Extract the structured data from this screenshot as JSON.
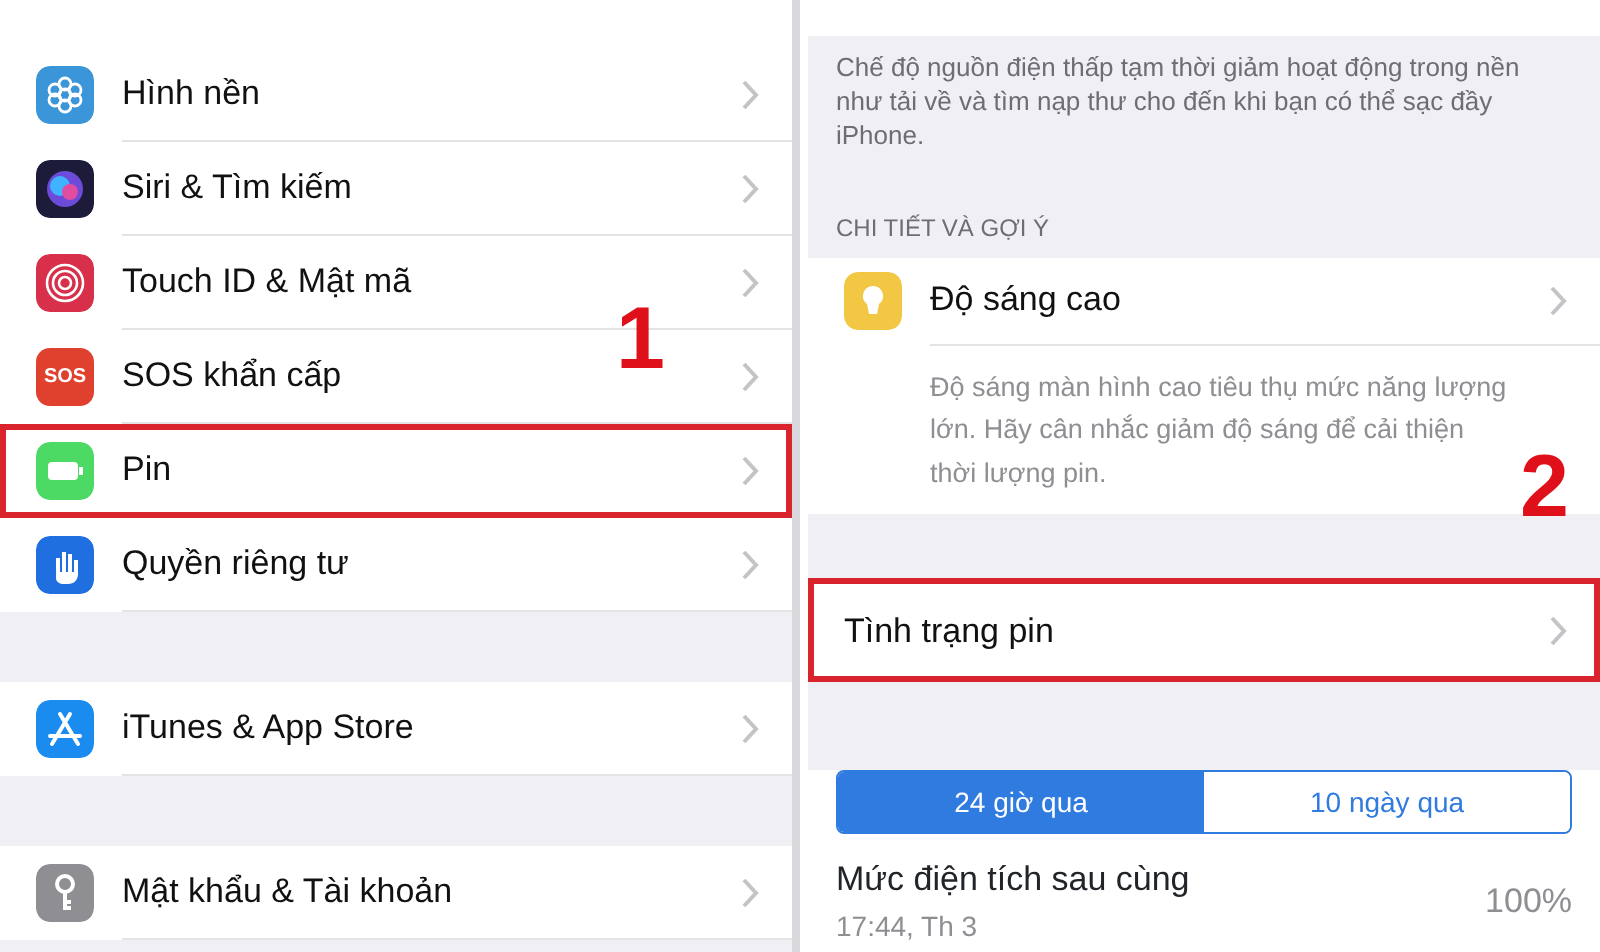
{
  "left_screen": {
    "groups": [
      {
        "items": [
          {
            "label": "Hình nền",
            "kind": "wallpaper",
            "highlighted": false
          },
          {
            "label": "Siri & Tìm kiếm",
            "kind": "siri",
            "highlighted": false
          },
          {
            "label": "Touch ID & Mật mã",
            "kind": "fingerprint",
            "highlighted": false
          },
          {
            "label": "SOS khẩn cấp",
            "kind": "sos",
            "icon_text": "SOS",
            "highlighted": false
          },
          {
            "label": "Pin",
            "kind": "battery",
            "highlighted": true
          },
          {
            "label": "Quyền riêng tư",
            "kind": "hand",
            "highlighted": false
          }
        ]
      },
      {
        "items": [
          {
            "label": "iTunes & App Store",
            "kind": "appstore",
            "highlighted": false
          }
        ]
      },
      {
        "items": [
          {
            "label": "Mật khẩu & Tài khoản",
            "kind": "key",
            "highlighted": false
          }
        ]
      }
    ],
    "step_label": "1"
  },
  "right_screen": {
    "low_power_note": "Chế độ nguồn điện thấp tạm thời giảm hoạt động trong nền như tải về và tìm nạp thư cho đến khi bạn có thể sạc đầy iPhone.",
    "section_header": "CHI TIẾT VÀ GỢI Ý",
    "suggestion": {
      "title": "Độ sáng cao",
      "description": "Độ sáng màn hình cao tiêu thụ mức năng lượng lớn. Hãy cân nhắc giảm độ sáng để cải thiện thời lượng pin."
    },
    "health_row": {
      "label": "Tình trạng pin",
      "highlighted": true
    },
    "segments": [
      {
        "label": "24 giờ qua",
        "selected": true
      },
      {
        "label": "10 ngày qua",
        "selected": false
      }
    ],
    "last_charge": {
      "title": "Mức điện tích sau cùng",
      "time": "17:44, Th 3",
      "value": "100%"
    },
    "step_label": "2"
  }
}
